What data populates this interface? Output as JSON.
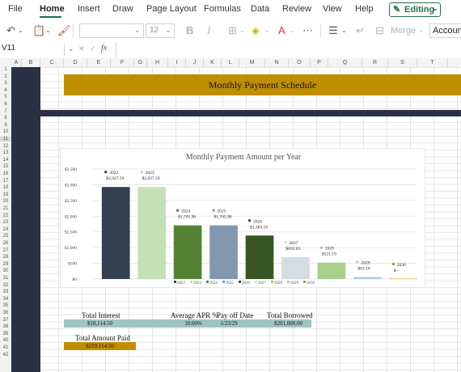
{
  "ribbon": {
    "tabs": [
      "File",
      "Home",
      "Insert",
      "Draw",
      "Page Layout",
      "Formulas",
      "Data",
      "Review",
      "View",
      "Help"
    ],
    "active_tab": "Home",
    "editing_label": "Editing"
  },
  "toolbar": {
    "font_size": "12",
    "merge_label": "Merge",
    "number_format": "Account"
  },
  "formula_bar": {
    "name_box": "V11",
    "fx": "fx",
    "formula": ""
  },
  "columns": [
    "A",
    "B",
    "C",
    "D",
    "E",
    "F",
    "G",
    "H",
    "I",
    "J",
    "K",
    "L",
    "M",
    "N",
    "O",
    "P",
    "Q",
    "R",
    "S",
    "T"
  ],
  "rows": [
    "1",
    "2",
    "3",
    "4",
    "5",
    "6",
    "7",
    "8",
    "9",
    "10",
    "11",
    "12",
    "13",
    "14",
    "15",
    "16",
    "17",
    "18",
    "19",
    "20",
    "21",
    "22",
    "23",
    "24",
    "25",
    "26",
    "27",
    "28",
    "29",
    "30",
    "31",
    "32",
    "33",
    "34",
    "35",
    "36",
    "37",
    "38",
    "39",
    "40",
    "41",
    "42"
  ],
  "sheet": {
    "title": "Monthly Payment Schedule",
    "total_interest_label": "Total Interest",
    "total_interest_value": "$18,114.50",
    "apr_label": "Average APR %",
    "apr_value": "10.00%",
    "payoff_label": "Pay off Date",
    "payoff_value": "1/23/29",
    "borrowed_label": "Total Borrowed",
    "borrowed_value": "$201,000.00",
    "paid_label": "Total Amount Paid",
    "paid_value": "$219,114.50"
  },
  "chart_data": {
    "type": "bar",
    "title": "Monthly Payment Amount per Year",
    "categories": [
      "2022",
      "2023",
      "2024",
      "2025",
      "2026",
      "2027",
      "2028",
      "2029",
      "2030"
    ],
    "values": [
      2927.59,
      2927.59,
      1705.9,
      1705.9,
      1383.19,
      693.83,
      521.19,
      63.1,
      0
    ],
    "data_labels": [
      "$2,927.59",
      "$2,927.59",
      "$1,705.90",
      "$1,705.90",
      "$1,383.19",
      "$693.83",
      "$521.19",
      "$63.10",
      "$-"
    ],
    "legend": [
      "2022",
      "2023",
      "2024",
      "2025",
      "2026",
      "2027",
      "2028",
      "2029",
      "2030"
    ],
    "colors": [
      "#323f4f",
      "#c5e0b4",
      "#548235",
      "#8497b0",
      "#375623",
      "#d6dce4",
      "#a9d18e",
      "#b4c7e7",
      "#bf8f00"
    ],
    "y_ticks": [
      "$0",
      "$500",
      "$1,000",
      "$1,500",
      "$2,000",
      "$2,500",
      "$3,000",
      "$3,500"
    ],
    "ylim": [
      0,
      3500
    ],
    "legend_position": "bottom",
    "grid": true
  }
}
